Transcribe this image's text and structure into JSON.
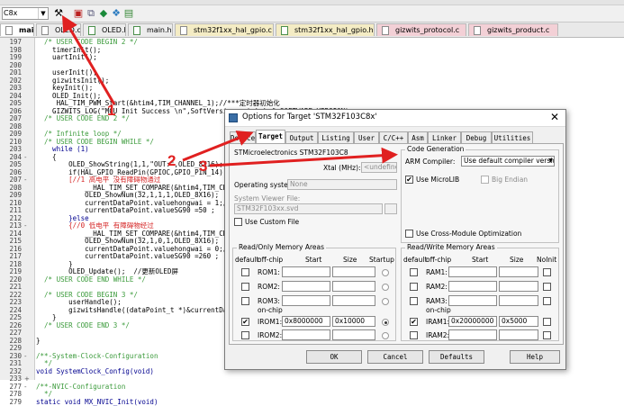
{
  "toolbar": {
    "target_combo_value": "C8x",
    "icons": [
      "target-options-icon",
      "download-icon",
      "copy-icon",
      "diamond-icon",
      "settings-icon",
      "manage-icon"
    ]
  },
  "tabs": [
    {
      "label": "main.c",
      "type": "c",
      "active": true
    },
    {
      "label": "OLED.c",
      "type": "c"
    },
    {
      "label": "OLED.h",
      "type": "h"
    },
    {
      "label": "main.h",
      "type": "h"
    },
    {
      "label": "stm32f1xx_hal_gpio.c",
      "type": "c",
      "color": "yellow"
    },
    {
      "label": "stm32f1xx_hal_gpio.h",
      "type": "h",
      "color": "yellow"
    },
    {
      "label": "gizwits_protocol.c",
      "type": "c",
      "color": "pink"
    },
    {
      "label": "gizwits_product.c",
      "type": "c",
      "color": "pink"
    }
  ],
  "editor": {
    "lines": [
      {
        "n": "197",
        "fold": "",
        "text": "  /* USER CODE BEGIN 2 */",
        "cls": "cm"
      },
      {
        "n": "198",
        "fold": "",
        "text": "    timerInit();",
        "cls": ""
      },
      {
        "n": "199",
        "fold": "",
        "text": "    uartInit();",
        "cls": ""
      },
      {
        "n": "200",
        "fold": "",
        "text": "",
        "cls": ""
      },
      {
        "n": "201",
        "fold": "",
        "text": "    userInit();",
        "cls": ""
      },
      {
        "n": "202",
        "fold": "",
        "text": "    gizwitsInit();",
        "cls": ""
      },
      {
        "n": "203",
        "fold": "",
        "text": "    keyInit();",
        "cls": ""
      },
      {
        "n": "204",
        "fold": "",
        "text": "    OLED_Init();",
        "cls": ""
      },
      {
        "n": "205",
        "fold": "",
        "text": "     HAL_TIM_PWM_Start(&htim4,TIM_CHANNEL_1);//***定时器初始化",
        "cls": ""
      },
      {
        "n": "206",
        "fold": "",
        "text": "    GIZWITS_LOG(\"MCU Init Success \\n\",SoftVersion = %s\\r\\n\",SOFTWARE_VERSION);",
        "cls": ""
      },
      {
        "n": "207",
        "fold": "",
        "text": "  /* USER CODE END 2 */",
        "cls": "cm"
      },
      {
        "n": "208",
        "fold": "",
        "text": "",
        "cls": ""
      },
      {
        "n": "209",
        "fold": "",
        "text": "  /* Infinite loop */",
        "cls": "cm"
      },
      {
        "n": "210",
        "fold": "",
        "text": "  /* USER CODE BEGIN WHILE */",
        "cls": "cm"
      },
      {
        "n": "203",
        "fold": "",
        "text": "    while (1)",
        "cls": "kw"
      },
      {
        "n": "204",
        "fold": "-",
        "text": "    {",
        "cls": ""
      },
      {
        "n": "205",
        "fold": "",
        "text": "        OLED_ShowString(1,1,\"OUT:\",OLED_8X16);",
        "cls": ""
      },
      {
        "n": "206",
        "fold": "",
        "text": "        if(HAL_GPIO_ReadPin(GPIOC,GPIO_PIN_14))",
        "cls": ""
      },
      {
        "n": "207",
        "fold": "-",
        "text": "        [//1 高电平 没有障碍物通过",
        "cls": "rd"
      },
      {
        "n": "208",
        "fold": "",
        "text": "            __HAL_TIM_SET_COMPARE(&htim4,TIM_CHANN",
        "cls": ""
      },
      {
        "n": "209",
        "fold": "",
        "text": "            OLED_ShowNum(32,1,1,1,OLED_8X16);",
        "cls": ""
      },
      {
        "n": "210",
        "fold": "",
        "text": "            currentDataPoint.valuehongwai = 1;//Ad",
        "cls": ""
      },
      {
        "n": "211",
        "fold": "",
        "text": "            currentDataPoint.valueSG90 =50 ;",
        "cls": ""
      },
      {
        "n": "212",
        "fold": "",
        "text": "        }else",
        "cls": "kw"
      },
      {
        "n": "213",
        "fold": "-",
        "text": "        {//0 低电平 有障碍物经过",
        "cls": "rd"
      },
      {
        "n": "214",
        "fold": "",
        "text": "            __HAL_TIM_SET_COMPARE(&htim4,TIM_CHANN",
        "cls": ""
      },
      {
        "n": "215",
        "fold": "",
        "text": "            OLED_ShowNum(32,1,0,1,OLED_8X16);",
        "cls": ""
      },
      {
        "n": "216",
        "fold": "",
        "text": "            currentDataPoint.valuehongwai = 0;//Ad",
        "cls": ""
      },
      {
        "n": "217",
        "fold": "",
        "text": "            currentDataPoint.valueSG90 =260 ;",
        "cls": ""
      },
      {
        "n": "218",
        "fold": "",
        "text": "        }",
        "cls": ""
      },
      {
        "n": "219",
        "fold": "",
        "text": "        OLED_Update();  //更新OLED屏",
        "cls": ""
      },
      {
        "n": "220",
        "fold": "",
        "text": "  /* USER CODE END WHILE */",
        "cls": "cm"
      },
      {
        "n": "221",
        "fold": "",
        "text": "",
        "cls": ""
      },
      {
        "n": "222",
        "fold": "",
        "text": "  /* USER CODE BEGIN 3 */",
        "cls": "cm"
      },
      {
        "n": "223",
        "fold": "",
        "text": "        userHandle();",
        "cls": ""
      },
      {
        "n": "224",
        "fold": "",
        "text": "        gizwitsHandle((dataPoint_t *)&currentDataP",
        "cls": ""
      },
      {
        "n": "225",
        "fold": "",
        "text": "    }",
        "cls": ""
      },
      {
        "n": "226",
        "fold": "",
        "text": "  /* USER CODE END 3 */",
        "cls": "cm"
      },
      {
        "n": "227",
        "fold": "",
        "text": "",
        "cls": ""
      },
      {
        "n": "228",
        "fold": "",
        "text": "}",
        "cls": ""
      },
      {
        "n": "229",
        "fold": "",
        "text": "",
        "cls": ""
      },
      {
        "n": "230",
        "fold": "-",
        "text": "/**-System-Clock-Configuration",
        "cls": "cm"
      },
      {
        "n": "231",
        "fold": "",
        "text": "  */",
        "cls": "cm"
      },
      {
        "n": "232",
        "fold": "",
        "text": "void SystemClock_Config(void)",
        "cls": "kw"
      },
      {
        "n": "233",
        "fold": "+",
        "text": "",
        "cls": ""
      },
      {
        "n": "277",
        "fold": "-",
        "text": "/**-NVIC-Configuration",
        "cls": "cm"
      },
      {
        "n": "278",
        "fold": "",
        "text": "  */",
        "cls": "cm"
      },
      {
        "n": "279",
        "fold": "",
        "text": "static void MX_NVIC_Init(void)",
        "cls": "kw"
      }
    ]
  },
  "dialog": {
    "title": "Options for Target 'STM32F103C8x'",
    "tabs": [
      "Device",
      "Target",
      "Output",
      "Listing",
      "User",
      "C/C++",
      "Asm",
      "Linker",
      "Debug",
      "Utilities"
    ],
    "active_tab": "Target",
    "device_name": "STMicroelectronics STM32F103C8",
    "xtal_label": "Xtal (MHz):",
    "xtal_value": "<undefined>",
    "os_label": "Operating system:",
    "os_value": "None",
    "sysviewer_label": "System Viewer File:",
    "sysviewer_value": "STM32F103xx.svd",
    "custom_file_label": "Use Custom File",
    "codegen": {
      "title": "Code Generation",
      "arm_compiler_label": "ARM Compiler:",
      "arm_compiler_value": "Use default compiler version 5",
      "microlib_label": "Use MicroLIB",
      "microlib_checked": true,
      "big_endian_label": "Big Endian",
      "cross_module_label": "Use Cross-Module Optimization"
    },
    "rom": {
      "title": "Read/Only Memory Areas",
      "headers": [
        "default",
        "off-chip",
        "Start",
        "Size",
        "Startup"
      ],
      "rows": [
        {
          "name": "ROM1:",
          "start": "",
          "size": "",
          "default": false,
          "startup": false
        },
        {
          "name": "ROM2:",
          "start": "",
          "size": "",
          "default": false,
          "startup": false
        },
        {
          "name": "ROM3:",
          "start": "",
          "size": "",
          "default": false,
          "startup": false
        },
        {
          "name": "IROM1:",
          "start": "0x8000000",
          "size": "0x10000",
          "default": true,
          "startup": true
        },
        {
          "name": "IROM2:",
          "start": "",
          "size": "",
          "default": false,
          "startup": false
        }
      ],
      "onchip_label": "on-chip"
    },
    "ram": {
      "title": "Read/Write Memory Areas",
      "headers": [
        "default",
        "off-chip",
        "Start",
        "Size",
        "NoInit"
      ],
      "rows": [
        {
          "name": "RAM1:",
          "start": "",
          "size": "",
          "default": false
        },
        {
          "name": "RAM2:",
          "start": "",
          "size": "",
          "default": false
        },
        {
          "name": "RAM3:",
          "start": "",
          "size": "",
          "default": false
        },
        {
          "name": "IRAM1:",
          "start": "0x20000000",
          "size": "0x5000",
          "default": true
        },
        {
          "name": "IRAM2:",
          "start": "",
          "size": "",
          "default": false
        }
      ],
      "onchip_label": "on-chip"
    },
    "buttons": {
      "ok": "OK",
      "cancel": "Cancel",
      "defaults": "Defaults",
      "help": "Help"
    }
  },
  "annotations": {
    "labels": [
      "1",
      "2",
      "3"
    ],
    "color": "#e02020"
  }
}
